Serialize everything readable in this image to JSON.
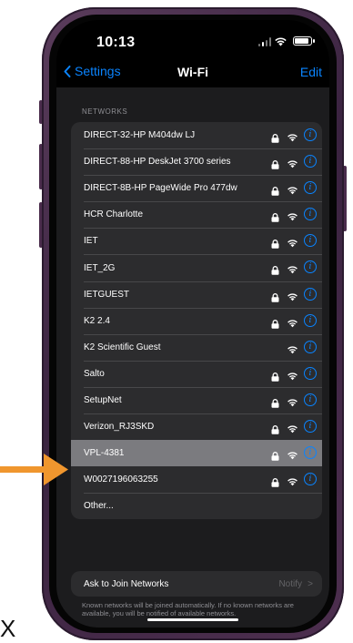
{
  "status_bar": {
    "time": "10:13"
  },
  "nav": {
    "back_label": "Settings",
    "title": "Wi-Fi",
    "edit_label": "Edit"
  },
  "section_label": "NETWORKS",
  "networks": [
    {
      "name": "DIRECT-32-HP M404dw LJ",
      "locked": true,
      "selected": false
    },
    {
      "name": "DIRECT-88-HP DeskJet 3700 series",
      "locked": true,
      "selected": false
    },
    {
      "name": "DIRECT-8B-HP PageWide Pro 477dw",
      "locked": true,
      "selected": false
    },
    {
      "name": "HCR Charlotte",
      "locked": true,
      "selected": false
    },
    {
      "name": "IET",
      "locked": true,
      "selected": false
    },
    {
      "name": "IET_2G",
      "locked": true,
      "selected": false
    },
    {
      "name": "IETGUEST",
      "locked": true,
      "selected": false
    },
    {
      "name": "K2 2.4",
      "locked": true,
      "selected": false
    },
    {
      "name": "K2 Scientific Guest",
      "locked": false,
      "selected": false
    },
    {
      "name": "Salto",
      "locked": true,
      "selected": false
    },
    {
      "name": "SetupNet",
      "locked": true,
      "selected": false
    },
    {
      "name": "Verizon_RJ3SKD",
      "locked": true,
      "selected": false
    },
    {
      "name": "VPL-4381",
      "locked": true,
      "selected": true
    },
    {
      "name": "W0027196063255",
      "locked": true,
      "selected": false
    },
    {
      "name": "Other...",
      "locked": false,
      "selected": false,
      "other": true
    }
  ],
  "ask_to_join": {
    "label": "Ask to Join Networks",
    "value": "Notify",
    "chevron": ">"
  },
  "footnote": "Known networks will be joined automatically. If no known networks are available, you will be notified of available networks.",
  "annotation": {
    "arrow_color": "#f0962e",
    "mark": "X"
  },
  "colors": {
    "accent": "#0a84ff",
    "background": "#1c1c1e",
    "card": "#2c2c2e",
    "selected_row": "#7b7b7f"
  }
}
